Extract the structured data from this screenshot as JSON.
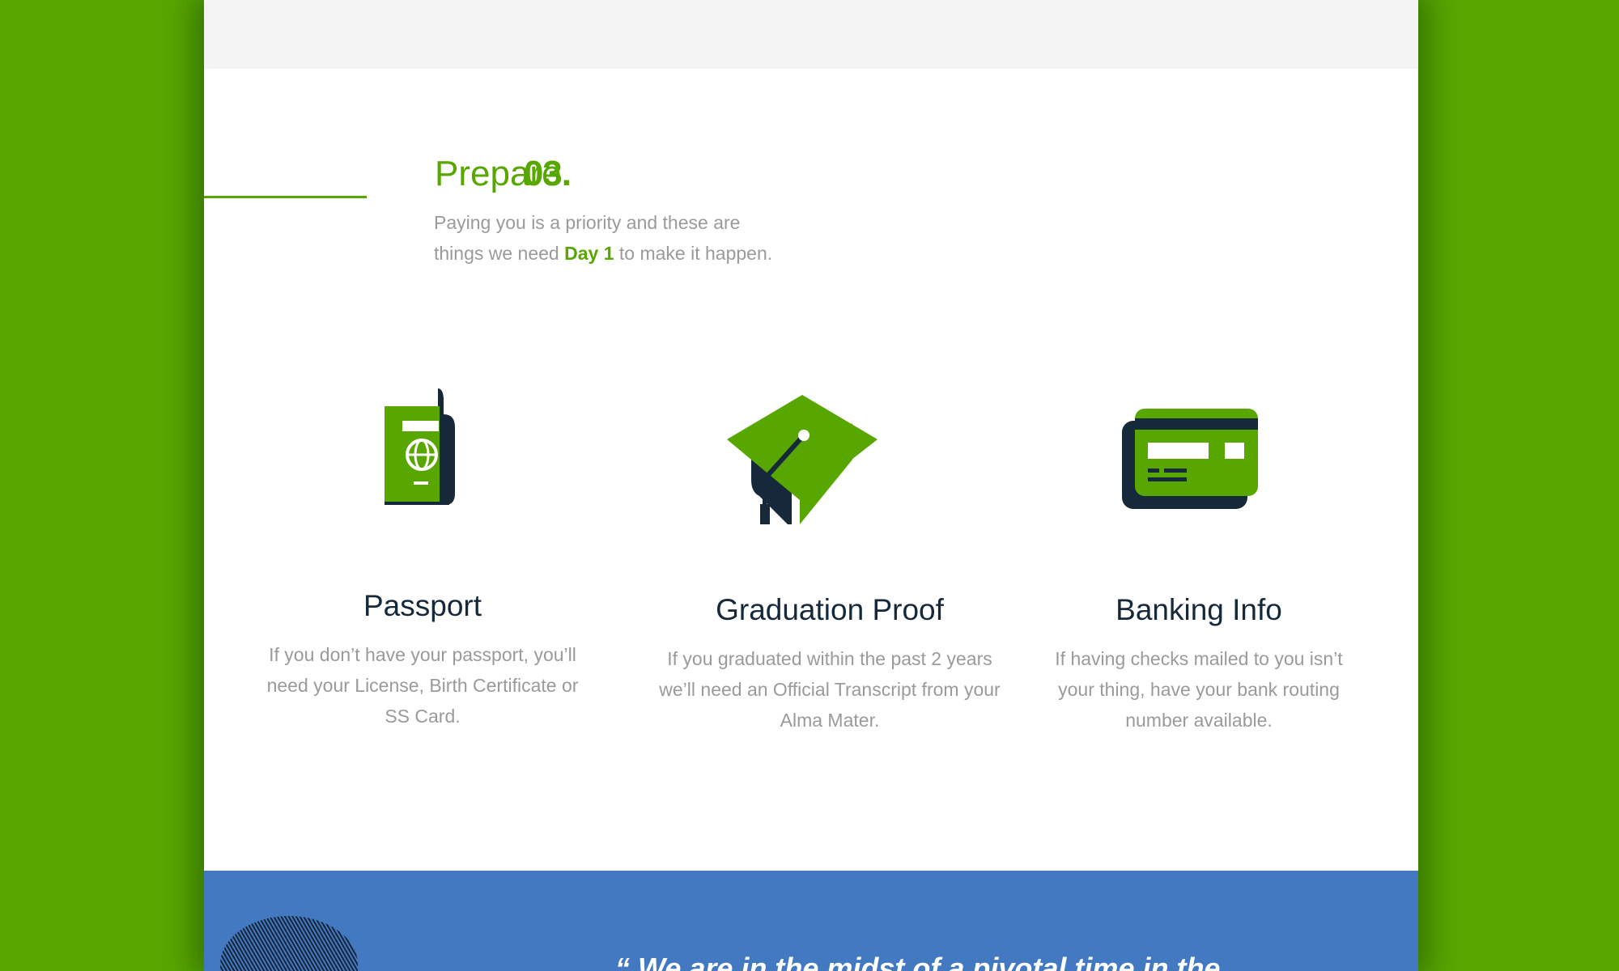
{
  "section": {
    "number": "03.",
    "title": "Prepare",
    "intro_before": "Paying you is a priority and these are things we need ",
    "intro_highlight": "Day 1",
    "intro_after": " to make it happen."
  },
  "items": [
    {
      "icon": "passport-icon",
      "title": "Passport",
      "description": "If you don’t have your passport, you’ll need your License, Birth Certificate or SS Card."
    },
    {
      "icon": "graduation-cap-icon",
      "title": "Graduation Proof",
      "description": "If you graduated within the past 2 years we’ll need an Official Transcript from your Alma Mater."
    },
    {
      "icon": "credit-card-icon",
      "title": "Banking Info",
      "description": "If having checks mailed to you isn’t your thing, have your bank routing number available."
    }
  ],
  "quote": {
    "text": "“ We are in the midst of a pivotal time in the"
  },
  "colors": {
    "background": "#58a700",
    "accent": "#58a700",
    "dark": "#16293a",
    "quote_band": "#4379c0"
  }
}
